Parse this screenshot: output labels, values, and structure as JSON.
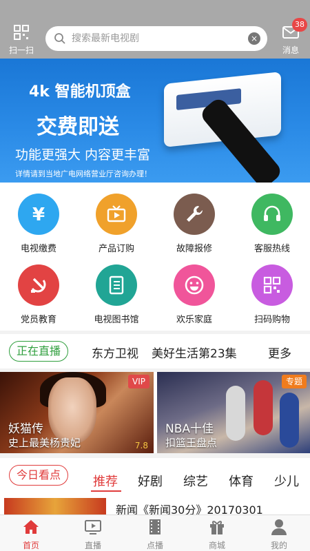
{
  "header": {
    "scan_label": "扫一扫",
    "search_placeholder": "搜索最新电视剧",
    "message_label": "消息",
    "message_badge": "38"
  },
  "banner": {
    "line1": "4k 智能机顶盒",
    "line2": "交费即送",
    "line3": "功能更强大 内容更丰富",
    "line4": "详情请到当地广电网络营业厅咨询办理！"
  },
  "services": [
    {
      "label": "电视缴费",
      "icon": "yen-icon",
      "color": "#2ea7f0"
    },
    {
      "label": "产品订购",
      "icon": "tv-icon",
      "color": "#f0a12b"
    },
    {
      "label": "故障报修",
      "icon": "wrench-icon",
      "color": "#7b5c4f"
    },
    {
      "label": "客服热线",
      "icon": "headset-icon",
      "color": "#3fb861"
    },
    {
      "label": "党员教育",
      "icon": "party-emblem-icon",
      "color": "#e24343"
    },
    {
      "label": "电视图书馆",
      "icon": "book-icon",
      "color": "#21a595"
    },
    {
      "label": "欢乐家庭",
      "icon": "smile-icon",
      "color": "#f0559a"
    },
    {
      "label": "扫码购物",
      "icon": "qr-code-icon",
      "color": "#c85ce0"
    }
  ],
  "live": {
    "label": "正在直播",
    "channel": "东方卫视",
    "show": "美好生活第23集",
    "more": "更多"
  },
  "cards": [
    {
      "title": "妖猫传",
      "subtitle": "史上最美杨贵妃",
      "tag": "VIP",
      "score": "7.8"
    },
    {
      "title": "NBA十佳",
      "subtitle": "扣篮王盘点",
      "tag": "专题"
    }
  ],
  "today": {
    "label": "今日看点",
    "tabs": [
      "推荐",
      "好剧",
      "综艺",
      "体育",
      "少儿"
    ],
    "news_title": "新闻《新闻30分》20170301"
  },
  "tabbar": [
    {
      "label": "首页",
      "icon": "home-icon",
      "active": true
    },
    {
      "label": "直播",
      "icon": "play-screen-icon",
      "active": false
    },
    {
      "label": "点播",
      "icon": "film-icon",
      "active": false
    },
    {
      "label": "商城",
      "icon": "gift-icon",
      "active": false
    },
    {
      "label": "我的",
      "icon": "user-icon",
      "active": false
    }
  ],
  "colors": {
    "accent_red": "#e03b3b",
    "live_green": "#2e9e3c",
    "header_gray": "#a9a9a9"
  }
}
